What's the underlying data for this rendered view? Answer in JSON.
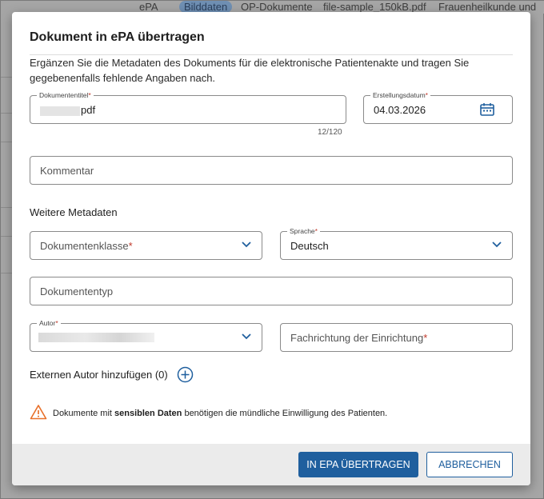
{
  "background": {
    "tabs": [
      "ePA",
      "Bilddaten",
      "OP-Dokumente",
      "file-sample_150kB.pdf",
      "Frauenheilkunde und"
    ]
  },
  "dialog": {
    "title": "Dokument in ePA übertragen",
    "intro": "Ergänzen Sie die Metadaten des Dokuments für die elektronische Patientenakte und tragen Sie gegebenenfalls fehlende Angaben nach.",
    "doc_title": {
      "label": "Dokumententitel",
      "required_mark": "*",
      "value_suffix": "pdf",
      "counter": "12/120"
    },
    "created_date": {
      "label": "Erstellungsdatum",
      "required_mark": "*",
      "value": "04.03.2026",
      "icon": "calendar-icon"
    },
    "comment": {
      "placeholder": "Kommentar"
    },
    "section_label": "Weitere Metadaten",
    "doc_class": {
      "placeholder": "Dokumentenklasse",
      "required_mark": "*"
    },
    "language": {
      "label": "Sprache",
      "required_mark": "*",
      "value": "Deutsch"
    },
    "doc_type": {
      "placeholder": "Dokumententyp"
    },
    "author": {
      "label": "Autor",
      "required_mark": "*"
    },
    "specialty": {
      "placeholder": "Fachrichtung der Einrichtung",
      "required_mark": "*"
    },
    "add_author": {
      "label": "Externen Autor hinzufügen (0)"
    },
    "warning": {
      "prefix": "Dokumente mit ",
      "bold": "sensiblen Daten",
      "suffix": " benötigen die mündliche Einwilligung des Patienten."
    },
    "buttons": {
      "submit": "IN EPA ÜBERTRAGEN",
      "cancel": "ABBRECHEN"
    }
  },
  "colors": {
    "primary": "#1f5f9e",
    "required": "#c0392b",
    "warning": "#e8702a",
    "add_icon": "#1f5f9e"
  }
}
